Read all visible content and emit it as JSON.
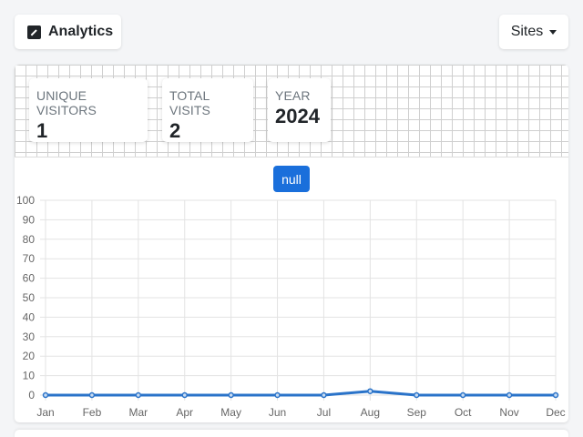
{
  "header": {
    "brand_label": "Analytics",
    "sites_label": "Sites"
  },
  "stats": [
    {
      "label": "UNIQUE VISITORS",
      "value": "1"
    },
    {
      "label": "TOTAL VISITS",
      "value": "2"
    },
    {
      "label": "YEAR",
      "value": "2024"
    }
  ],
  "toggle_label": "null",
  "colors": {
    "accent": "#1a6fdb",
    "line": "#2a73c9"
  },
  "chart_data": {
    "type": "line",
    "categories": [
      "Jan",
      "Feb",
      "Mar",
      "Apr",
      "May",
      "Jun",
      "Jul",
      "Aug",
      "Sep",
      "Oct",
      "Nov",
      "Dec"
    ],
    "series": [
      {
        "values": [
          0,
          0,
          0,
          0,
          0,
          0,
          0,
          2,
          0,
          0,
          0,
          0
        ]
      }
    ],
    "yticks": [
      0,
      10,
      20,
      30,
      40,
      50,
      60,
      70,
      80,
      90,
      100
    ],
    "ylim": [
      0,
      100
    ],
    "grid": true,
    "legend": "none",
    "title": "",
    "xlabel": "",
    "ylabel": ""
  }
}
